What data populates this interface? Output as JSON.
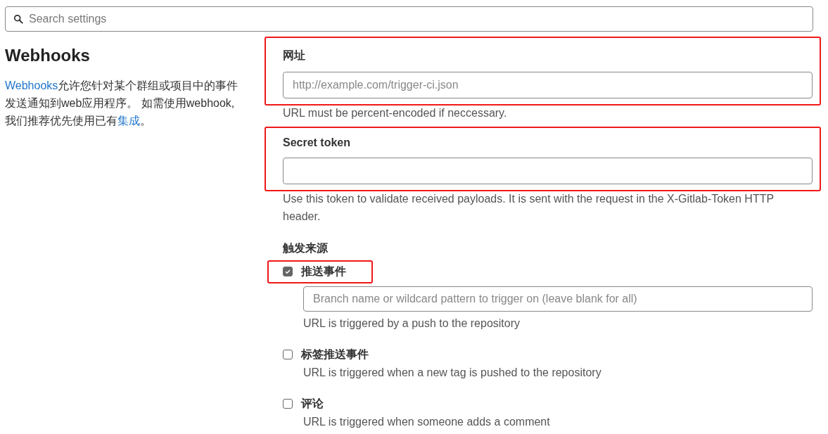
{
  "search": {
    "placeholder": "Search settings"
  },
  "section": {
    "title": "Webhooks",
    "description": [
      {
        "text": "Webhooks",
        "link": true
      },
      {
        "text": "允许您针对某个群组或项目中的事件发送通知到web应用程序。 如需使用webhook, 我们推荐优先使用已有",
        "link": false
      },
      {
        "text": "集成",
        "link": true
      },
      {
        "text": "。",
        "link": false
      }
    ]
  },
  "fields": [
    {
      "label": "网址",
      "placeholder": "http://example.com/trigger-ci.json",
      "help": "URL must be percent-encoded if neccessary.",
      "highlighted": true
    },
    {
      "label": "Secret token",
      "help": "Use this token to validate received payloads. It is sent with the request in the X-Gitlab-Token HTTP header.",
      "highlighted": true
    }
  ],
  "triggers": {
    "title": "触发来源",
    "items": [
      {
        "label": "推送事件",
        "checked": true,
        "highlighted": true,
        "placeholder": "Branch name or wildcard pattern to trigger on (leave blank for all)",
        "help": "URL is triggered by a push to the repository"
      },
      {
        "label": "标签推送事件",
        "checked": false,
        "highlighted": false,
        "help": "URL is triggered when a new tag is pushed to the repository"
      },
      {
        "label": "评论",
        "checked": false,
        "highlighted": false,
        "help": "URL is triggered when someone adds a comment"
      }
    ]
  }
}
